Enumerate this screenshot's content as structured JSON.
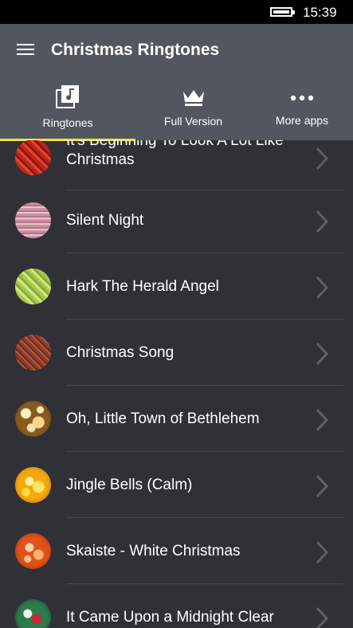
{
  "status_bar": {
    "time": "15:39",
    "battery_icon": "battery-icon"
  },
  "header": {
    "menu_icon": "hamburger-menu-icon",
    "title": "Christmas Ringtones"
  },
  "tabs": [
    {
      "label": "Ringtones",
      "icon": "music-library-icon",
      "selected": true
    },
    {
      "label": "Full Version",
      "icon": "crown-icon",
      "selected": false
    },
    {
      "label": "More apps",
      "icon": "more-dots-icon",
      "selected": false
    }
  ],
  "accent_color": "#f4e04d",
  "ringtones": [
    {
      "title": "It's Beginning To Look A Lot Like Christmas",
      "thumb": "red-stripes"
    },
    {
      "title": "Silent Night",
      "thumb": "pink-stripes"
    },
    {
      "title": "Hark The Herald Angel",
      "thumb": "green-stripes"
    },
    {
      "title": "Christmas Song",
      "thumb": "brown-stripes"
    },
    {
      "title": "Oh, Little Town of Bethlehem",
      "thumb": "golden-bokeh"
    },
    {
      "title": "Jingle Bells (Calm)",
      "thumb": "yellow-bokeh"
    },
    {
      "title": "Skaiste - White Christmas",
      "thumb": "orange-bokeh"
    },
    {
      "title": "It Came Upon a Midnight Clear",
      "thumb": "ornaments"
    }
  ]
}
